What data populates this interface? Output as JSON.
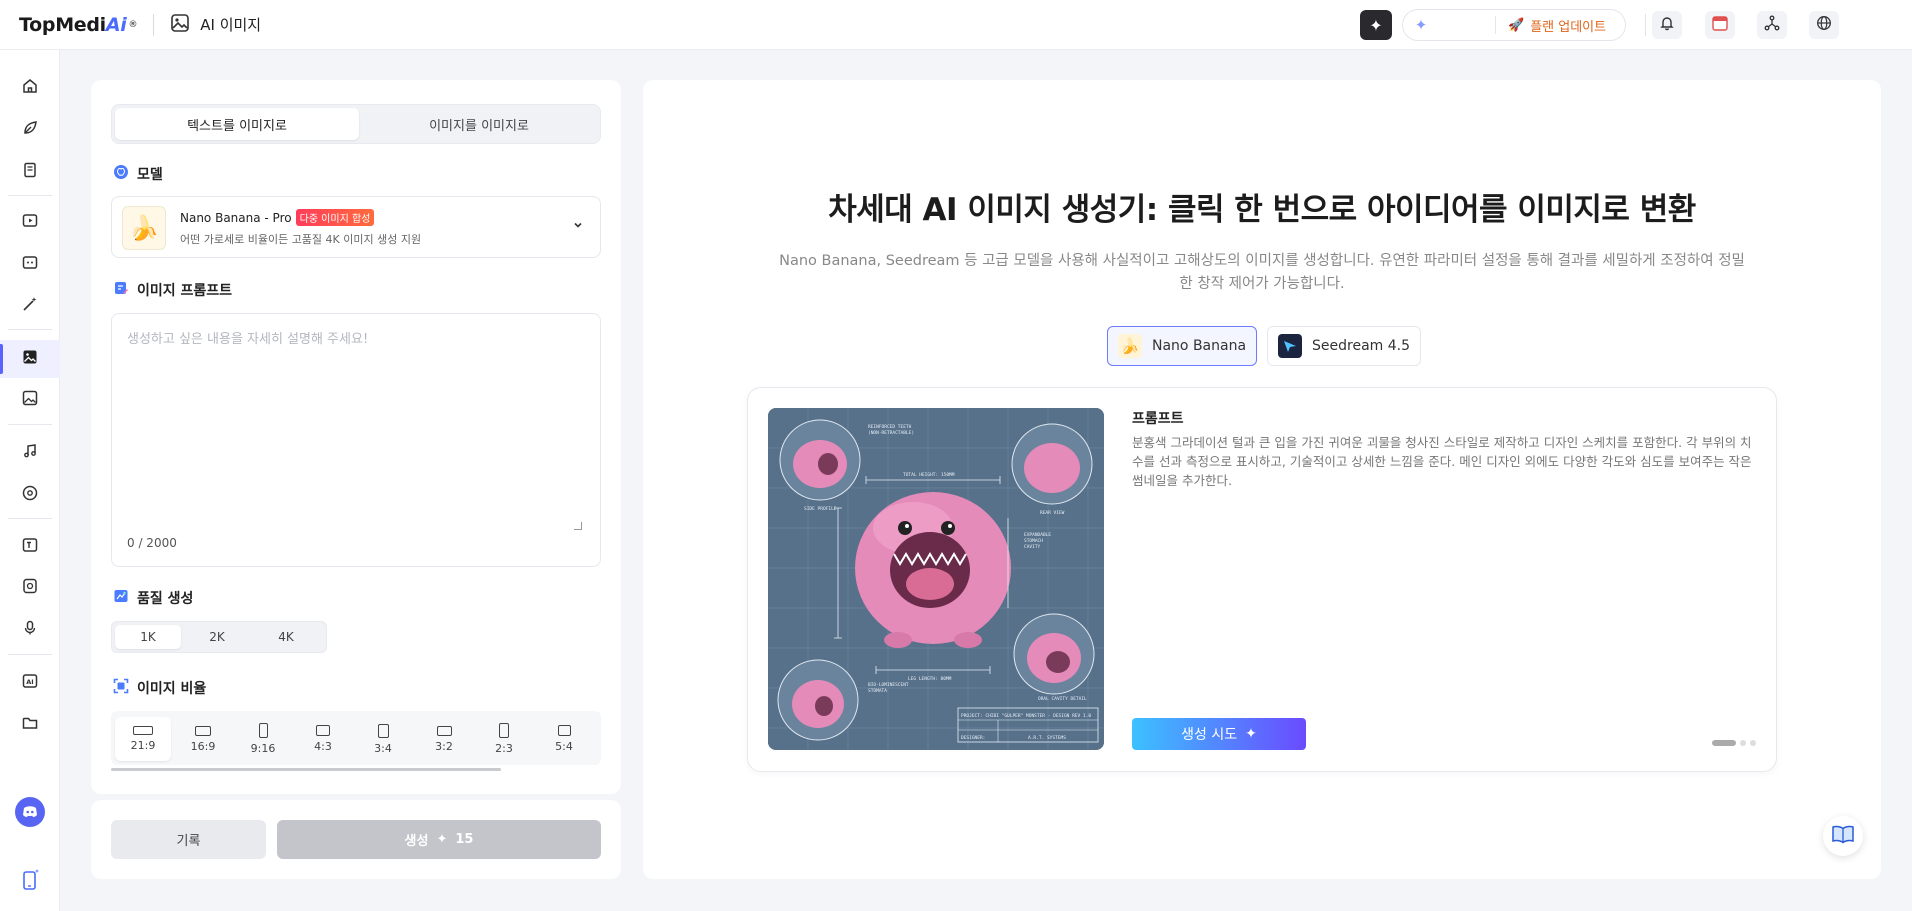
{
  "header": {
    "brand_main": "TopMedi",
    "brand_ai": "Ai",
    "brand_reg": "®",
    "page_title": "AI 이미지",
    "upgrade_label": "플랜 업데이트"
  },
  "left": {
    "tabs": [
      {
        "label": "텍스트를 이미지로",
        "active": true
      },
      {
        "label": "이미지를 이미지로",
        "active": false
      }
    ],
    "model_section": "모델",
    "model": {
      "name": "Nano Banana - Pro",
      "badge": "다중 이미지 합성",
      "description": "어떤 가로세로 비율이든 고품질 4K 이미지 생성 지원"
    },
    "prompt_section": "이미지 프롬프트",
    "prompt_placeholder": "생성하고 싶은 내용을 자세히 설명해 주세요!",
    "char_count": "0 / 2000",
    "quality_section": "품질 생성",
    "quality_options": [
      "1K",
      "2K",
      "4K"
    ],
    "ratio_section": "이미지 비율",
    "ratios": [
      "21:9",
      "16:9",
      "9:16",
      "4:3",
      "3:4",
      "3:2",
      "2:3",
      "5:4"
    ],
    "history_label": "기록",
    "generate_label": "생성",
    "generate_cost": "15"
  },
  "right": {
    "title": "차세대 AI 이미지 생성기: 클릭 한 번으로 아이디어를 이미지로 변환",
    "subtitle": "Nano Banana, Seedream 등 고급 모델을 사용해 사실적이고 고해상도의 이미지를 생성합니다. 유연한 파라미터 설정을 통해 결과를 세밀하게 조정하여 정밀한 창작 제어가 가능합니다.",
    "model_tabs": [
      {
        "label": "Nano Banana",
        "active": true
      },
      {
        "label": "Seedream 4.5",
        "active": false
      }
    ],
    "showcase": {
      "prompt_title": "프롬프트",
      "prompt_text": "분홍색 그라데이션 털과 큰 입을 가진 귀여운 괴물을 청사진 스타일로 제작하고 디자인 스케치를 포함한다. 각 부위의 치수를 선과 측정으로 표시하고, 기술적이고 상세한 느낌을 준다. 메인 디자인 외에도 다양한 각도와 심도를 보여주는 작은 썸네일을 추가한다.",
      "try_label": "생성 시도"
    }
  },
  "colors": {
    "accent": "#5b63ff",
    "upgrade": "#e0661b",
    "blueprint": "#57718b",
    "monster": "#e58bb9"
  }
}
